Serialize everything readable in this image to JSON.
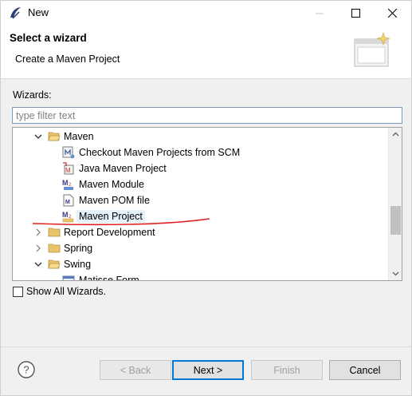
{
  "window": {
    "title": "New"
  },
  "header": {
    "title": "Select a wizard",
    "description": "Create a Maven Project"
  },
  "wizards_label": "Wizards:",
  "filter": {
    "placeholder": "type filter text",
    "value": ""
  },
  "tree": {
    "rows": [
      {
        "label": "Maven",
        "kind": "folder",
        "expanded": true,
        "icon": "folder-open-icon"
      },
      {
        "label": "Checkout Maven Projects from SCM",
        "kind": "item",
        "icon": "maven-checkout-icon"
      },
      {
        "label": "Java Maven Project",
        "kind": "item",
        "icon": "java-maven-icon"
      },
      {
        "label": "Maven Module",
        "kind": "item",
        "icon": "maven-module-icon"
      },
      {
        "label": "Maven POM file",
        "kind": "item",
        "icon": "maven-pom-icon"
      },
      {
        "label": "Maven Project",
        "kind": "item",
        "selected": true,
        "icon": "maven-project-icon"
      },
      {
        "label": "Report Development",
        "kind": "folder",
        "expanded": false,
        "icon": "folder-icon"
      },
      {
        "label": "Spring",
        "kind": "folder",
        "expanded": false,
        "icon": "folder-icon"
      },
      {
        "label": "Swing",
        "kind": "folder",
        "expanded": true,
        "icon": "folder-open-icon"
      },
      {
        "label": "Matisse Form",
        "kind": "item",
        "icon": "form-icon"
      }
    ]
  },
  "show_all": {
    "label": "Show All Wizards.",
    "checked": false
  },
  "buttons": {
    "back": "< Back",
    "next": "Next >",
    "finish": "Finish",
    "cancel": "Cancel"
  },
  "colors": {
    "accent": "#0078d7",
    "selection": "#e5f1fb",
    "annotation": "#e02020"
  }
}
